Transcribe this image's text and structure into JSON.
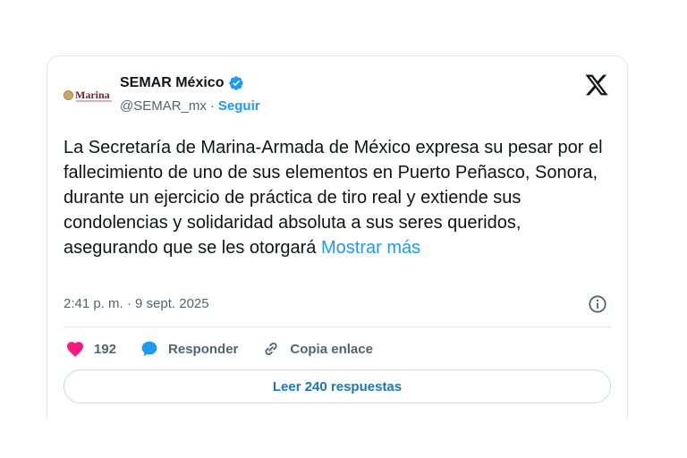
{
  "account": {
    "avatar_text": "Marina",
    "display_name": "SEMAR México",
    "handle": "@SEMAR_mx",
    "separator": "·",
    "follow_label": "Seguir"
  },
  "tweet": {
    "text": "La Secretaría de Marina-Armada de México expresa su pesar por el fallecimiento de uno de sus elementos en Puerto Peñasco, Sonora, durante un ejercicio de práctica de tiro real y extiende sus condolencias y solidaridad absoluta a sus seres queridos, asegurando que se les otorgará",
    "show_more_label": "Mostrar más",
    "timestamp": "2:41 p. m. · 9 sept. 2025"
  },
  "actions": {
    "like_count": "192",
    "reply_label": "Responder",
    "copy_link_label": "Copia enlace"
  },
  "read_replies_label": "Leer 240 respuestas",
  "colors": {
    "accent": "#1d9bf0",
    "like": "#f91880",
    "text": "#0f1419",
    "muted": "#536471",
    "border": "#e1e8ed"
  },
  "icons": [
    "verified-badge-icon",
    "x-logo-icon",
    "info-icon",
    "heart-icon",
    "reply-bubble-icon",
    "link-icon"
  ]
}
